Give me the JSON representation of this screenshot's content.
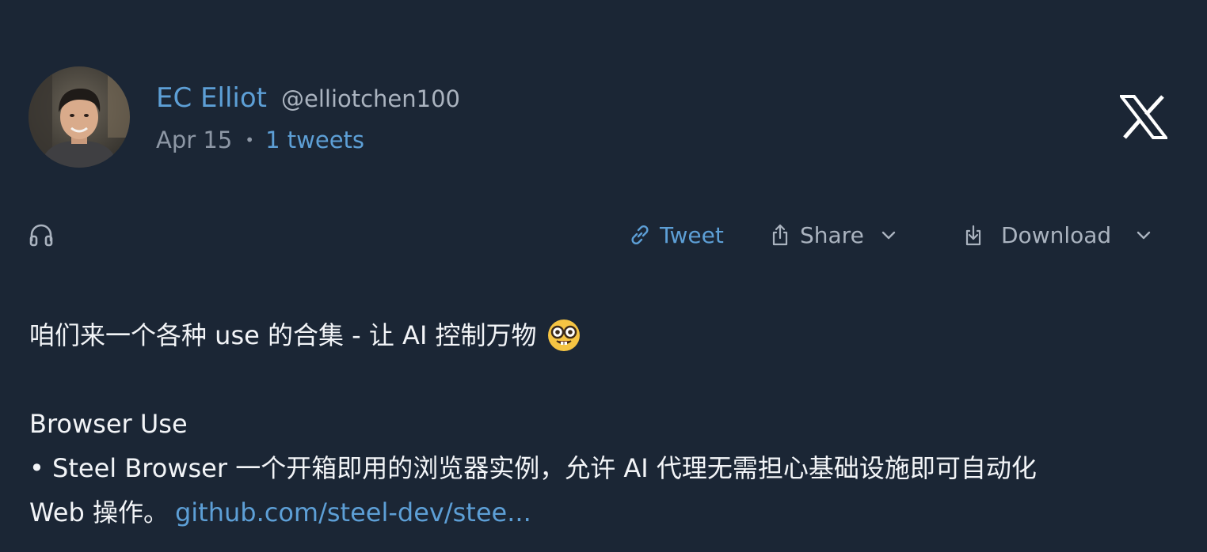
{
  "author": {
    "display_name": "EC Elliot",
    "handle": "@elliotchen100",
    "date": "Apr 15",
    "separator": "•",
    "tweet_count": "1 tweets",
    "avatar_icon": "person-photo"
  },
  "toolbar": {
    "listen_icon": "headphones-icon",
    "tweet_label": "Tweet",
    "share_label": "Share",
    "download_label": "Download"
  },
  "content": {
    "line1": "咱们来一个各种 use 的合集 - 让 AI 控制万物",
    "line1_emoji": "nerd-face",
    "section_title": "Browser Use",
    "bullet_line": "• Steel Browser 一个开箱即用的浏览器实例，允许 AI 代理无需担心基础设施即可自动化",
    "line_last_text": "Web 操作。",
    "link_text": "github.com/steel-dev/stee..."
  },
  "colors": {
    "background": "#1b2635",
    "accent": "#5d9fd6",
    "text": "#f2f4f7",
    "muted": "#aab3bf"
  }
}
